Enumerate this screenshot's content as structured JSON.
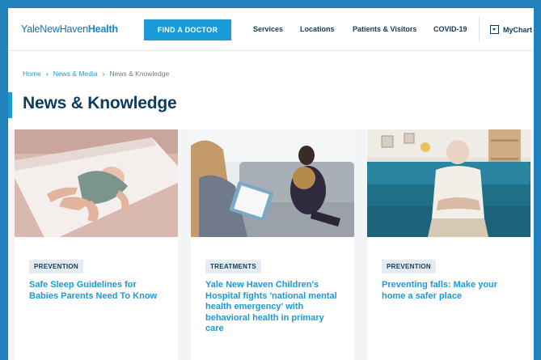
{
  "header": {
    "logo_light": "YaleNewHaven",
    "logo_bold": "Health",
    "find_doctor": "FIND A DOCTOR",
    "nav": [
      "Services",
      "Locations",
      "Patients & Visitors",
      "COVID-19"
    ],
    "mychart": "MyChart"
  },
  "breadcrumb": [
    "Home",
    "News & Media",
    "News & Knowledge"
  ],
  "page_title": "News & Knowledge",
  "cards": [
    {
      "tag": "PREVENTION",
      "title": "Safe Sleep Guidelines for Babies Parents Need To Know"
    },
    {
      "tag": "TREATMENTS",
      "title": "Yale New Haven Children's Hospital fights 'national mental health emergency' with behavioral health in primary care"
    },
    {
      "tag": "PREVENTION",
      "title": "Preventing falls: Make your home a safer place"
    }
  ],
  "colors": {
    "frame": "#1f82bd",
    "accent": "#1a9ad6",
    "navy": "#0f3a5c",
    "tag_bg": "#e6ebf1"
  }
}
